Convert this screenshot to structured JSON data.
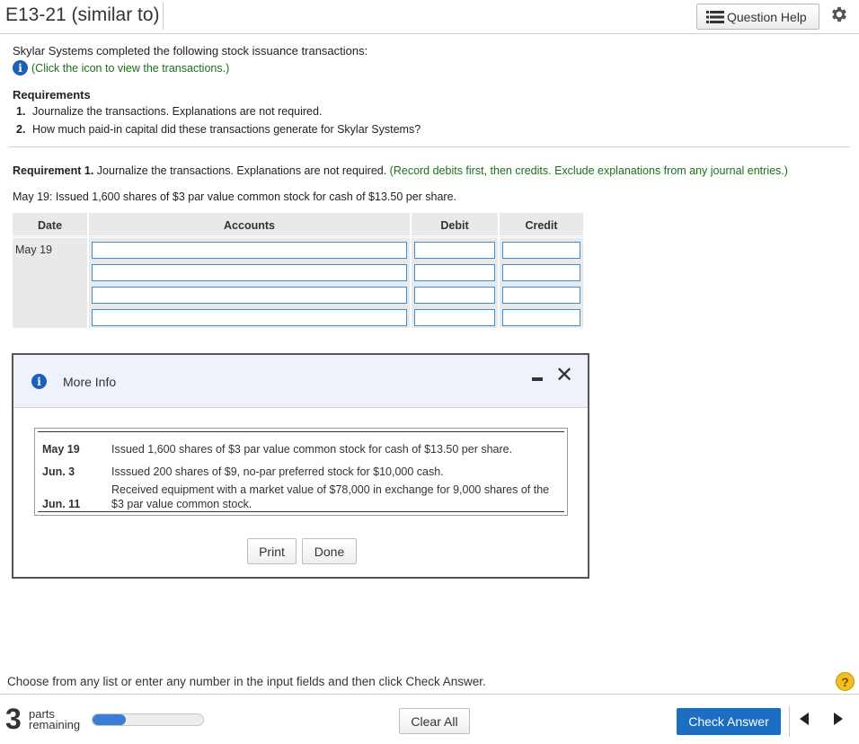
{
  "header": {
    "title": "E13-21 (similar to)",
    "question_help": "Question Help"
  },
  "intro": {
    "text": "Skylar Systems completed the following stock issuance transactions:",
    "info_link": "(Click the icon to view the transactions.)"
  },
  "requirements": {
    "title": "Requirements",
    "items": [
      {
        "num": "1.",
        "text": "Journalize the transactions. Explanations are not required."
      },
      {
        "num": "2.",
        "text": "How much paid-in capital did these transactions generate for Skylar Systems?"
      }
    ]
  },
  "requirement1": {
    "label": "Requirement 1.",
    "text": " Journalize the transactions. Explanations are not required. ",
    "hint": "(Record debits first, then credits. Exclude explanations from any journal entries.)",
    "transaction_desc": "May 19: Issued 1,600 shares of $3 par value common stock for cash of $13.50 per share."
  },
  "journal": {
    "headers": {
      "date": "Date",
      "accounts": "Accounts",
      "debit": "Debit",
      "credit": "Credit"
    },
    "date_value": "May 19",
    "rows": [
      {
        "account": "",
        "debit": "",
        "credit": ""
      },
      {
        "account": "",
        "debit": "",
        "credit": ""
      },
      {
        "account": "",
        "debit": "",
        "credit": ""
      },
      {
        "account": "",
        "debit": "",
        "credit": ""
      }
    ]
  },
  "modal": {
    "title": "More Info",
    "transactions": [
      {
        "date": "May 19",
        "text": "Issued 1,600 shares of $3 par value common stock for cash of $13.50 per share."
      },
      {
        "date": "Jun. 3",
        "text": "Isssued 200 shares of $9, no-par preferred stock for $10,000 cash."
      },
      {
        "date": "Jun. 11",
        "text": "Received equipment with a market value of $78,000 in exchange for 9,000 shares of the $3 par value common stock."
      }
    ],
    "print_label": "Print",
    "done_label": "Done"
  },
  "footer": {
    "instructions": "Choose from any list or enter any number in the input fields and then click Check Answer.",
    "help": "?",
    "parts_count": "3",
    "parts_line1": "parts",
    "parts_line2": "remaining",
    "progress_fraction": 0.3,
    "clear_all": "Clear All",
    "check_answer": "Check Answer"
  },
  "colors": {
    "accent": "#1b6ec2",
    "info_icon": "#1e5fb8",
    "hint_green": "#1a6f1a",
    "input_border": "#3d8fd0",
    "help_yellow": "#f0c020"
  },
  "icons": {
    "question_help": "list-icon",
    "settings": "gear-icon",
    "info": "info-icon",
    "minimize": "minimize-icon",
    "close": "close-icon",
    "prev": "triangle-left-icon",
    "next": "triangle-right-icon"
  }
}
